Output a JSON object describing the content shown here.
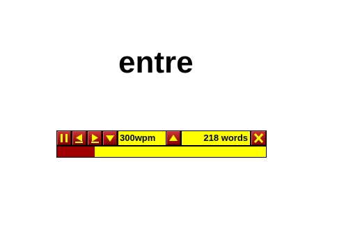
{
  "reader": {
    "current_word": "entre"
  },
  "toolbar": {
    "buttons": [
      {
        "name": "pause",
        "icon": "pause-icon"
      },
      {
        "name": "previous",
        "icon": "step-back-icon"
      },
      {
        "name": "next",
        "icon": "step-forward-icon"
      },
      {
        "name": "slower",
        "icon": "triangle-down-icon"
      },
      {
        "name": "faster",
        "icon": "triangle-up-icon"
      },
      {
        "name": "close",
        "icon": "close-x-icon"
      }
    ],
    "speed_label": "300wpm",
    "word_count_label": "218 words"
  },
  "progress": {
    "fraction": 0.18
  },
  "colors": {
    "button": "#a01010",
    "icon": "#ffff00",
    "field": "#ffff00",
    "progress_fill": "#a00000",
    "border": "#000000"
  }
}
